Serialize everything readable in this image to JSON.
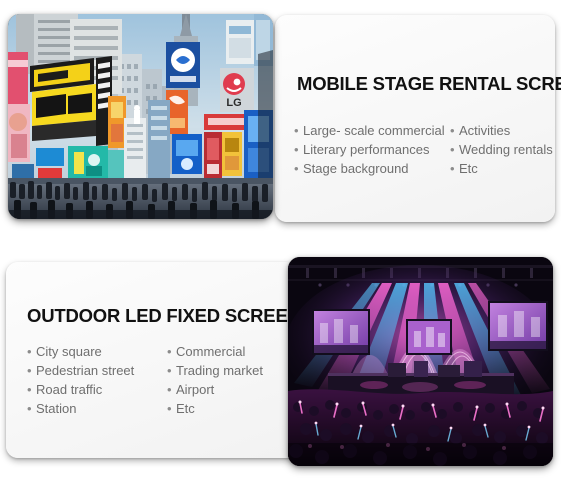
{
  "page": {
    "background_color": "#ffffff",
    "card_background_color": "#f7f7f7",
    "title_color": "#111111",
    "bullet_text_color": "#6f6f6f",
    "bullet_glyph": "•"
  },
  "sections": [
    {
      "id": "mobile-stage-rental-screen",
      "title": "MOBILE STAGE RENTAL SCREEN",
      "image": {
        "name": "times-square-city-billboards-photo",
        "alt": "Busy city square at dusk with large illuminated advertising billboards and crowds of people",
        "position": "left"
      },
      "bullets_left": [
        "Large- scale commercial",
        "Literary performances",
        "Stage background"
      ],
      "bullets_right": [
        "Activities",
        "Wedding rentals",
        "Etc"
      ]
    },
    {
      "id": "outdoor-led-fixed-screen",
      "title": "OUTDOOR LED FIXED SCREEN",
      "image": {
        "name": "concert-stage-led-screen-photo",
        "alt": "Large indoor concert with pink and blue stage lighting, LED side screens and a packed crowd",
        "position": "right"
      },
      "bullets_left": [
        "City square",
        "Pedestrian street",
        "Road traffic",
        "Station"
      ],
      "bullets_right": [
        "Commercial",
        "Trading market",
        "Airport",
        "Etc"
      ]
    }
  ]
}
